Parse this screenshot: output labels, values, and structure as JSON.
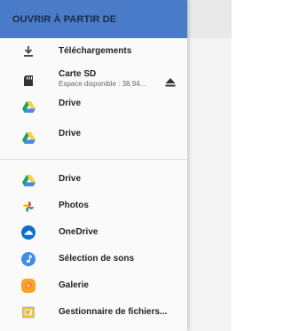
{
  "header": {
    "title": "OUVRIR À PARTIR DE"
  },
  "locations": [
    {
      "label": "Téléchargements",
      "icon": "download-icon"
    },
    {
      "label": "Carte SD",
      "sub": "Espace disponible : 38,94...",
      "icon": "sd-card-icon",
      "action_icon": "eject-icon"
    },
    {
      "label": "Drive",
      "icon": "google-drive-icon"
    },
    {
      "label": "Drive",
      "icon": "google-drive-icon"
    }
  ],
  "apps": [
    {
      "label": "Drive",
      "icon": "google-drive-icon"
    },
    {
      "label": "Photos",
      "icon": "google-photos-icon"
    },
    {
      "label": "OneDrive",
      "icon": "onedrive-icon"
    },
    {
      "label": "Sélection de sons",
      "icon": "sound-picker-icon"
    },
    {
      "label": "Galerie",
      "icon": "gallery-icon"
    },
    {
      "label": "Gestionnaire de fichiers...",
      "icon": "file-manager-icon"
    }
  ],
  "colors": {
    "header_bg": "#4a7bc8",
    "header_text": "#1a2b4a",
    "drive_green": "#1da462",
    "drive_yellow": "#ffcd40",
    "drive_blue": "#4688f4",
    "onedrive_blue": "#0a6fd0",
    "sounds_blue": "#3d8ce8",
    "gallery_orange": "#f5a623",
    "file_manager_yellow": "#f4c542"
  }
}
